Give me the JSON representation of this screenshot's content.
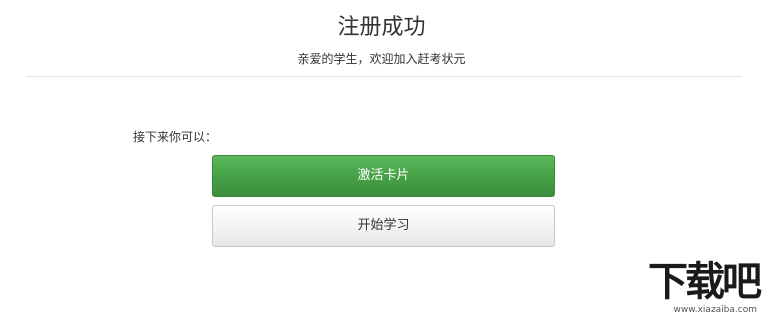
{
  "header": {
    "title": "注册成功",
    "subtitle": "亲爱的学生，欢迎加入赶考状元"
  },
  "main": {
    "next_label": "接下来你可以：",
    "primary_button_label": "激活卡片",
    "secondary_button_label": "开始学习"
  },
  "watermark": {
    "main": "下载吧",
    "sub": "www.xiazaiba.com"
  },
  "colors": {
    "primary_button": "#45a045",
    "text": "#333333",
    "divider": "#e4e4e4"
  }
}
